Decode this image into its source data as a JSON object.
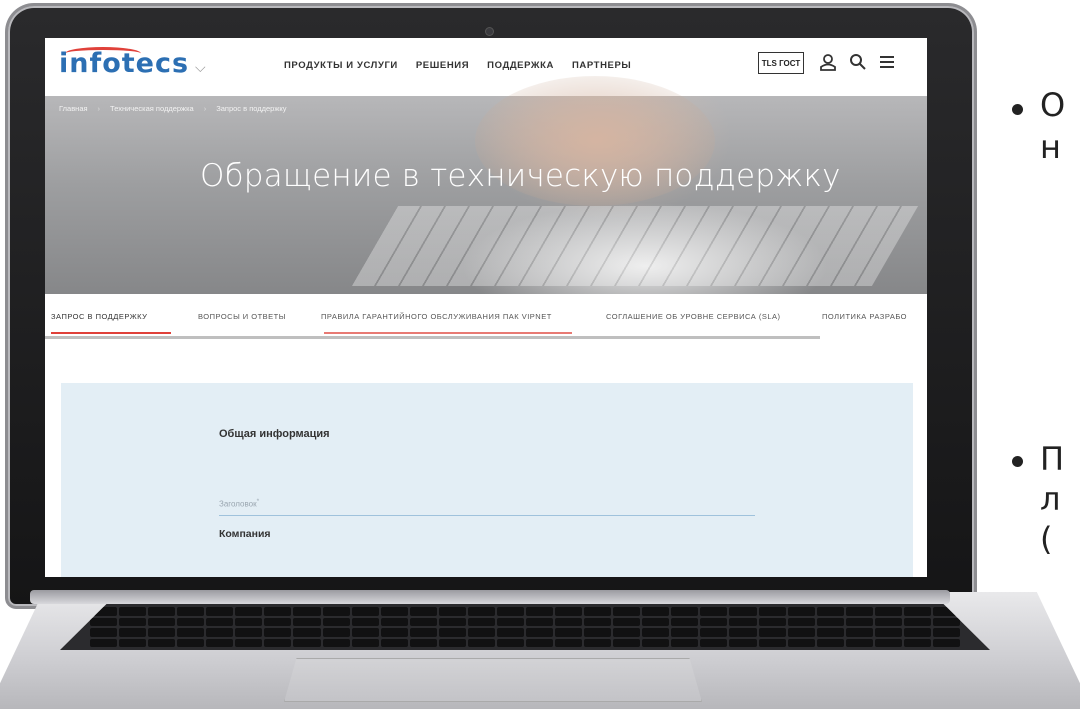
{
  "site": {
    "logo": "infotecs",
    "nav": [
      "ПРОДУКТЫ И УСЛУГИ",
      "РЕШЕНИЯ",
      "ПОДДЕРЖКА",
      "ПАРТНЕРЫ"
    ],
    "tls_button": "TLS ГОСТ",
    "icons": [
      "user-icon",
      "search-icon",
      "menu-icon"
    ],
    "breadcrumb": [
      "Главная",
      "Техническая поддержка",
      "Запрос в поддержку"
    ],
    "hero_title": "Обращение в техническую поддержку",
    "tabs": [
      "ЗАПРОС В ПОДДЕРЖКУ",
      "ВОПРОСЫ И ОТВЕТЫ",
      "ПРАВИЛА ГАРАНТИЙНОГО ОБСЛУЖИВАНИЯ ПАК VIPNET",
      "СОГЛАШЕНИЕ ОБ УРОВНЕ СЕРВИСА (SLA)",
      "ПОЛИТИКА РАЗРАБО"
    ],
    "form": {
      "section_general": "Общая информация",
      "title_placeholder": "Заголовок",
      "required_mark": "*",
      "section_company": "Компания"
    }
  },
  "slide_bullets": [
    {
      "lines": [
        "О",
        "н"
      ]
    },
    {
      "lines": [
        "П",
        "л",
        "("
      ]
    }
  ],
  "colors": {
    "brand_blue": "#2c6fb3",
    "accent_red": "#e0413a",
    "form_bg": "#e3eef5"
  }
}
